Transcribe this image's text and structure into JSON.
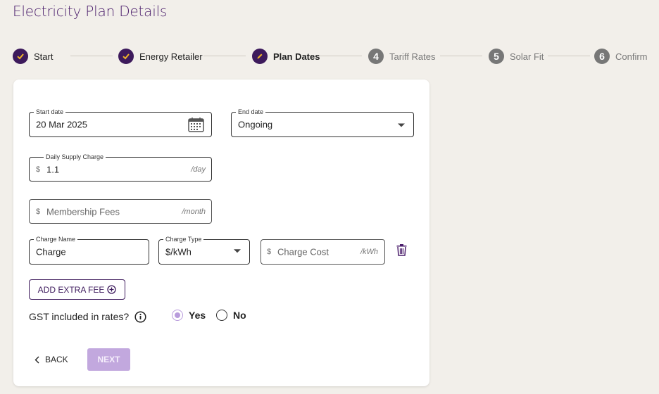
{
  "page": {
    "title": "Electricity Plan Details"
  },
  "stepper": {
    "steps": [
      {
        "label": "Start",
        "status": "done"
      },
      {
        "label": "Energy Retailer",
        "status": "done"
      },
      {
        "label": "Plan Dates",
        "status": "active"
      },
      {
        "number": "4",
        "label": "Tariff Rates",
        "status": "pending"
      },
      {
        "number": "5",
        "label": "Solar Fit",
        "status": "pending"
      },
      {
        "number": "6",
        "label": "Confirm",
        "status": "pending"
      }
    ]
  },
  "form": {
    "start_date": {
      "label": "Start date",
      "value": "20 Mar 2025"
    },
    "end_date": {
      "label": "End date",
      "value": "Ongoing"
    },
    "daily_supply": {
      "label": "Daily Supply Charge",
      "prefix": "$",
      "value": "1.1",
      "suffix": "/day"
    },
    "membership": {
      "placeholder": "Membership Fees",
      "prefix": "$",
      "suffix": "/month"
    },
    "charge_name": {
      "label": "Charge Name",
      "value": "Charge"
    },
    "charge_type": {
      "label": "Charge Type",
      "value": "$/kWh"
    },
    "charge_cost": {
      "placeholder": "Charge Cost",
      "prefix": "$",
      "suffix": "/kWh"
    },
    "add_extra_fee_label": "ADD EXTRA FEE",
    "gst": {
      "question": "GST included in rates?",
      "yes_label": "Yes",
      "no_label": "No",
      "selected": "Yes"
    }
  },
  "actions": {
    "back_label": "BACK",
    "next_label": "NEXT"
  },
  "colors": {
    "primary": "#3d1a5c",
    "accent_light": "#c2a8de",
    "background": "#f2efea"
  }
}
